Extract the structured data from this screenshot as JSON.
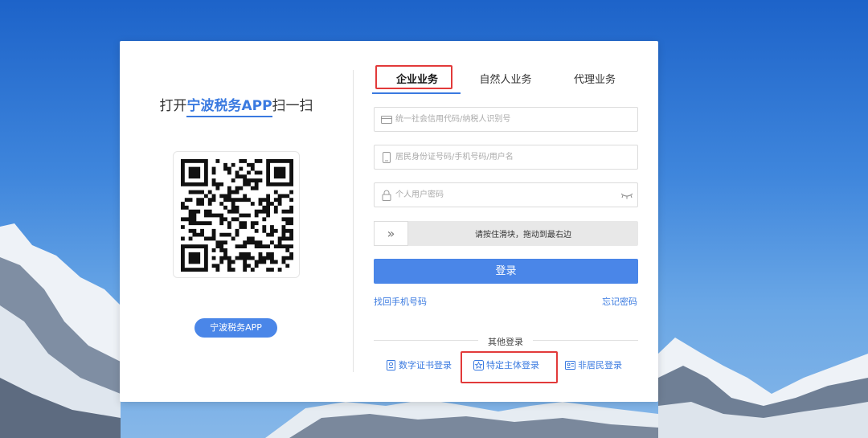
{
  "left": {
    "scan_prefix": "打开",
    "scan_app": "宁波税务APP",
    "scan_suffix": "扫一扫",
    "app_button": "宁波税务APP"
  },
  "tabs": [
    {
      "label": "企业业务",
      "active": true
    },
    {
      "label": "自然人业务",
      "active": false
    },
    {
      "label": "代理业务",
      "active": false
    }
  ],
  "form": {
    "credit_code_placeholder": "统一社会信用代码/纳税人识别号",
    "id_placeholder": "居民身份证号码/手机号码/用户名",
    "password_placeholder": "个人用户密码",
    "slider_text": "请按住滑块，拖动到最右边",
    "slider_handle": "»",
    "login_label": "登录",
    "find_phone": "找回手机号码",
    "forgot_password": "忘记密码"
  },
  "other_login": {
    "title": "其他登录",
    "options": [
      {
        "label": "数字证书登录",
        "icon": "certificate-icon"
      },
      {
        "label": "特定主体登录",
        "icon": "star-badge-icon"
      },
      {
        "label": "非居民登录",
        "icon": "id-card-icon"
      }
    ]
  },
  "colors": {
    "accent": "#4a86e8",
    "highlight": "#e23a3a"
  }
}
